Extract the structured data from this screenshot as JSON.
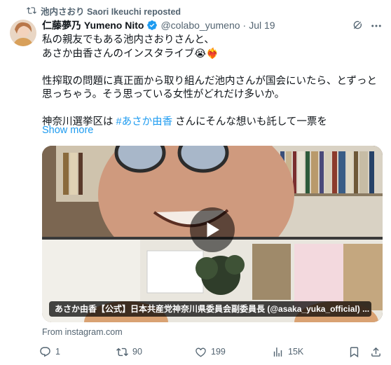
{
  "repost": {
    "text": "池内さおり Saori Ikeuchi reposted",
    "icon": "repost-icon"
  },
  "author": {
    "name": "仁藤夢乃 Yumeno Nito",
    "handle": "@colabo_yumeno",
    "separator": "·",
    "date": "Jul 19",
    "verified": true
  },
  "tweet": {
    "line1": "私の親友でもある池内さおりさんと、",
    "line2": "あさか由香さんのインスタライブ😭❤️‍🔥",
    "para2": "性搾取の問題に真正面から取り組んだ池内さんが国会にいたら、とずっと思っちゃう。そう思っている女性がどれだけ多いか。",
    "para3_prefix": "神奈川選挙区は ",
    "hashtag": "#あさか由香",
    "para3_suffix": " さんにそんな想いも託して一票を",
    "show_more": "Show more"
  },
  "media": {
    "caption": "あさか由香【公式】日本共産党神奈川県委員会副委員長 (@asaka_yuka_official) ...",
    "play_icon": "play-icon"
  },
  "source": "From instagram.com",
  "actions": {
    "replies": "1",
    "reposts": "90",
    "likes": "199",
    "views": "15K"
  },
  "colors": {
    "link": "#1d9bf0",
    "muted": "#536471",
    "text": "#0f1419"
  }
}
